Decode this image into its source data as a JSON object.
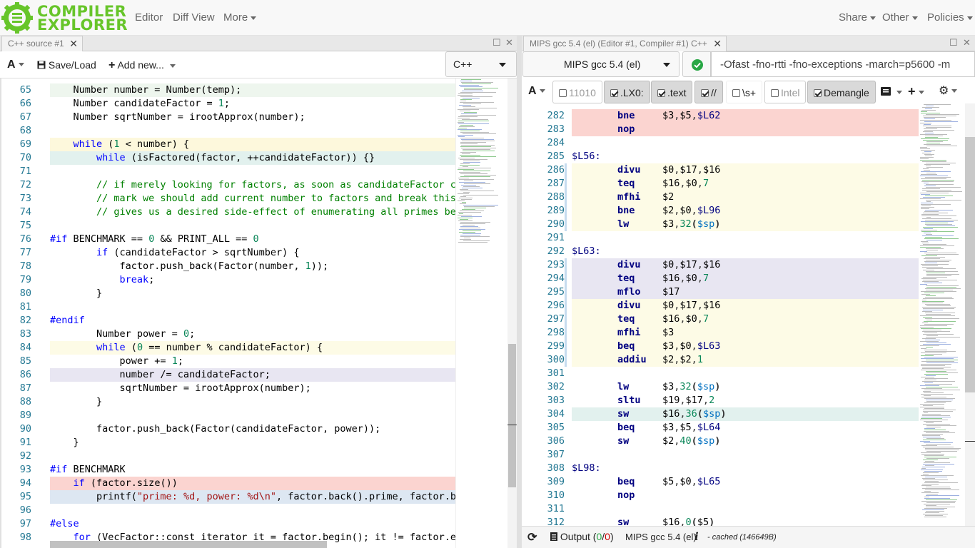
{
  "nav": {
    "logo_line1": "COMPILER",
    "logo_line2": "EXPLORER",
    "editor": "Editor",
    "diff_view": "Diff View",
    "more": "More",
    "share": "Share",
    "other": "Other",
    "policies": "Policies"
  },
  "source_pane": {
    "tab_title": "C++ source #1",
    "font_btn": "A",
    "save_load": "Save/Load",
    "add_new": "Add new...",
    "language": "C++",
    "lines": [
      {
        "n": "65",
        "hl": "#eef6ee",
        "html": "    Number number = Number(temp);"
      },
      {
        "n": "66",
        "hl": "",
        "html": "    Number candidateFactor = 1;"
      },
      {
        "n": "67",
        "hl": "",
        "html": "    Number sqrtNumber = irootApprox(number);"
      },
      {
        "n": "68",
        "hl": "",
        "html": ""
      },
      {
        "n": "69",
        "hl": "#fdf8dc",
        "html": "    while (1 < number) {"
      },
      {
        "n": "70",
        "hl": "#e2f1ee",
        "html": "        while (isFactored(factor, ++candidateFactor)) {}"
      },
      {
        "n": "71",
        "hl": "",
        "html": ""
      },
      {
        "n": "72",
        "hl": "",
        "html": "        // if merely looking for factors, as soon as candidateFactor cr"
      },
      {
        "n": "73",
        "hl": "",
        "html": "        // mark we should add current number to factors and break this"
      },
      {
        "n": "74",
        "hl": "",
        "html": "        // gives us a desired side-effect of enumerating all primes bel"
      },
      {
        "n": "75",
        "hl": "",
        "html": ""
      },
      {
        "n": "76",
        "hl": "",
        "html": "#if BENCHMARK == 0 && PRINT_ALL == 0"
      },
      {
        "n": "77",
        "hl": "",
        "html": "        if (candidateFactor > sqrtNumber) {"
      },
      {
        "n": "78",
        "hl": "",
        "html": "            factor.push_back(Factor(number, 1));"
      },
      {
        "n": "79",
        "hl": "",
        "html": "            break;"
      },
      {
        "n": "80",
        "hl": "",
        "html": "        }"
      },
      {
        "n": "81",
        "hl": "",
        "html": ""
      },
      {
        "n": "82",
        "hl": "",
        "html": "#endif"
      },
      {
        "n": "83",
        "hl": "",
        "html": "        Number power = 0;"
      },
      {
        "n": "84",
        "hl": "#fdfbe6",
        "html": "        while (0 == number % candidateFactor) {"
      },
      {
        "n": "85",
        "hl": "",
        "html": "            power += 1;"
      },
      {
        "n": "86",
        "hl": "#e8e6f2",
        "html": "            number /= candidateFactor;"
      },
      {
        "n": "87",
        "hl": "",
        "html": "            sqrtNumber = irootApprox(number);"
      },
      {
        "n": "88",
        "hl": "",
        "html": "        }"
      },
      {
        "n": "89",
        "hl": "",
        "html": ""
      },
      {
        "n": "90",
        "hl": "",
        "html": "        factor.push_back(Factor(candidateFactor, power));"
      },
      {
        "n": "91",
        "hl": "",
        "html": "    }"
      },
      {
        "n": "92",
        "hl": "",
        "html": ""
      },
      {
        "n": "93",
        "hl": "",
        "html": "#if BENCHMARK"
      },
      {
        "n": "94",
        "hl": "#fbd4d0",
        "html": "    if (factor.size())"
      },
      {
        "n": "95",
        "hl": "#dde7f2",
        "html": "        printf(\"prime: %d, power: %d\\n\", factor.back().prime, factor.ba"
      },
      {
        "n": "96",
        "hl": "",
        "html": ""
      },
      {
        "n": "97",
        "hl": "",
        "html": "#else"
      },
      {
        "n": "98",
        "hl": "",
        "html": "    for (VecFactor::const_iterator it = factor.begin(); it != factor.en"
      }
    ]
  },
  "compiler_pane": {
    "tab_title": "MIPS gcc 5.4 (el) (Editor #1, Compiler #1) C++",
    "compiler": "MIPS gcc 5.4 (el)",
    "options": "-Ofast -fno-rtti -fno-exceptions  -march=p5600 -m",
    "filters": {
      "binary": "11010",
      "labels": ".LX0:",
      "directives": ".text",
      "comments": "//",
      "whitespace": "\\s+",
      "intel": "Intel",
      "demangle": "Demangle"
    },
    "lines": [
      {
        "n": "282",
        "hl": "#fbd4d0",
        "op": "bne",
        "args": "$3,$5,$L62"
      },
      {
        "n": "283",
        "hl": "#fbd4d0",
        "op": "nop",
        "args": ""
      },
      {
        "n": "284",
        "hl": "",
        "op": "",
        "args": ""
      },
      {
        "n": "285",
        "hl": "",
        "label": "$L56:"
      },
      {
        "n": "286",
        "hl": "#fdfbe6",
        "op": "divu",
        "args": "$0,$17,$16"
      },
      {
        "n": "287",
        "hl": "#fdfbe6",
        "op": "teq",
        "args": "$16,$0,7"
      },
      {
        "n": "288",
        "hl": "#fdfbe6",
        "op": "mfhi",
        "args": "$2"
      },
      {
        "n": "289",
        "hl": "#fdfbe6",
        "op": "bne",
        "args": "$2,$0,$L96"
      },
      {
        "n": "290",
        "hl": "#fdfbe6",
        "op": "lw",
        "args": "$3,32($sp)"
      },
      {
        "n": "291",
        "hl": "",
        "op": "",
        "args": ""
      },
      {
        "n": "292",
        "hl": "",
        "label": "$L63:"
      },
      {
        "n": "293",
        "hl": "#e8e6f2",
        "op": "divu",
        "args": "$0,$17,$16"
      },
      {
        "n": "294",
        "hl": "#e8e6f2",
        "op": "teq",
        "args": "$16,$0,7"
      },
      {
        "n": "295",
        "hl": "#e8e6f2",
        "op": "mflo",
        "args": "$17"
      },
      {
        "n": "296",
        "hl": "#fdfbe6",
        "op": "divu",
        "args": "$0,$17,$16"
      },
      {
        "n": "297",
        "hl": "#fdfbe6",
        "op": "teq",
        "args": "$16,$0,7"
      },
      {
        "n": "298",
        "hl": "#fdfbe6",
        "op": "mfhi",
        "args": "$3"
      },
      {
        "n": "299",
        "hl": "#fdfbe6",
        "op": "beq",
        "args": "$3,$0,$L63"
      },
      {
        "n": "300",
        "hl": "#fdfbe6",
        "op": "addiu",
        "args": "$2,$2,1"
      },
      {
        "n": "301",
        "hl": "",
        "op": "",
        "args": ""
      },
      {
        "n": "302",
        "hl": "",
        "op": "lw",
        "args": "$3,32($sp)"
      },
      {
        "n": "303",
        "hl": "",
        "op": "sltu",
        "args": "$19,$17,2"
      },
      {
        "n": "304",
        "hl": "#e2f1ee",
        "op": "sw",
        "args": "$16,36($sp)"
      },
      {
        "n": "305",
        "hl": "",
        "op": "beq",
        "args": "$3,$5,$L64"
      },
      {
        "n": "306",
        "hl": "",
        "op": "sw",
        "args": "$2,40($sp)"
      },
      {
        "n": "307",
        "hl": "",
        "op": "",
        "args": ""
      },
      {
        "n": "308",
        "hl": "",
        "label": "$L98:"
      },
      {
        "n": "309",
        "hl": "",
        "op": "beq",
        "args": "$5,$0,$L65"
      },
      {
        "n": "310",
        "hl": "",
        "op": "nop",
        "args": ""
      },
      {
        "n": "311",
        "hl": "",
        "op": "",
        "args": ""
      },
      {
        "n": "312",
        "hl": "",
        "op": "sw",
        "args": "$16,0($5)"
      }
    ]
  },
  "bottom": {
    "output": "Output (",
    "output_ok": "0",
    "output_sep": "/",
    "output_err": "0",
    "output_end": ")",
    "compiler_name": "MIPS gcc 5.4 (el)",
    "cached": "- cached (146649B)"
  },
  "colors": {
    "brand_green": "#67c52a",
    "ok_green": "#28a745"
  }
}
